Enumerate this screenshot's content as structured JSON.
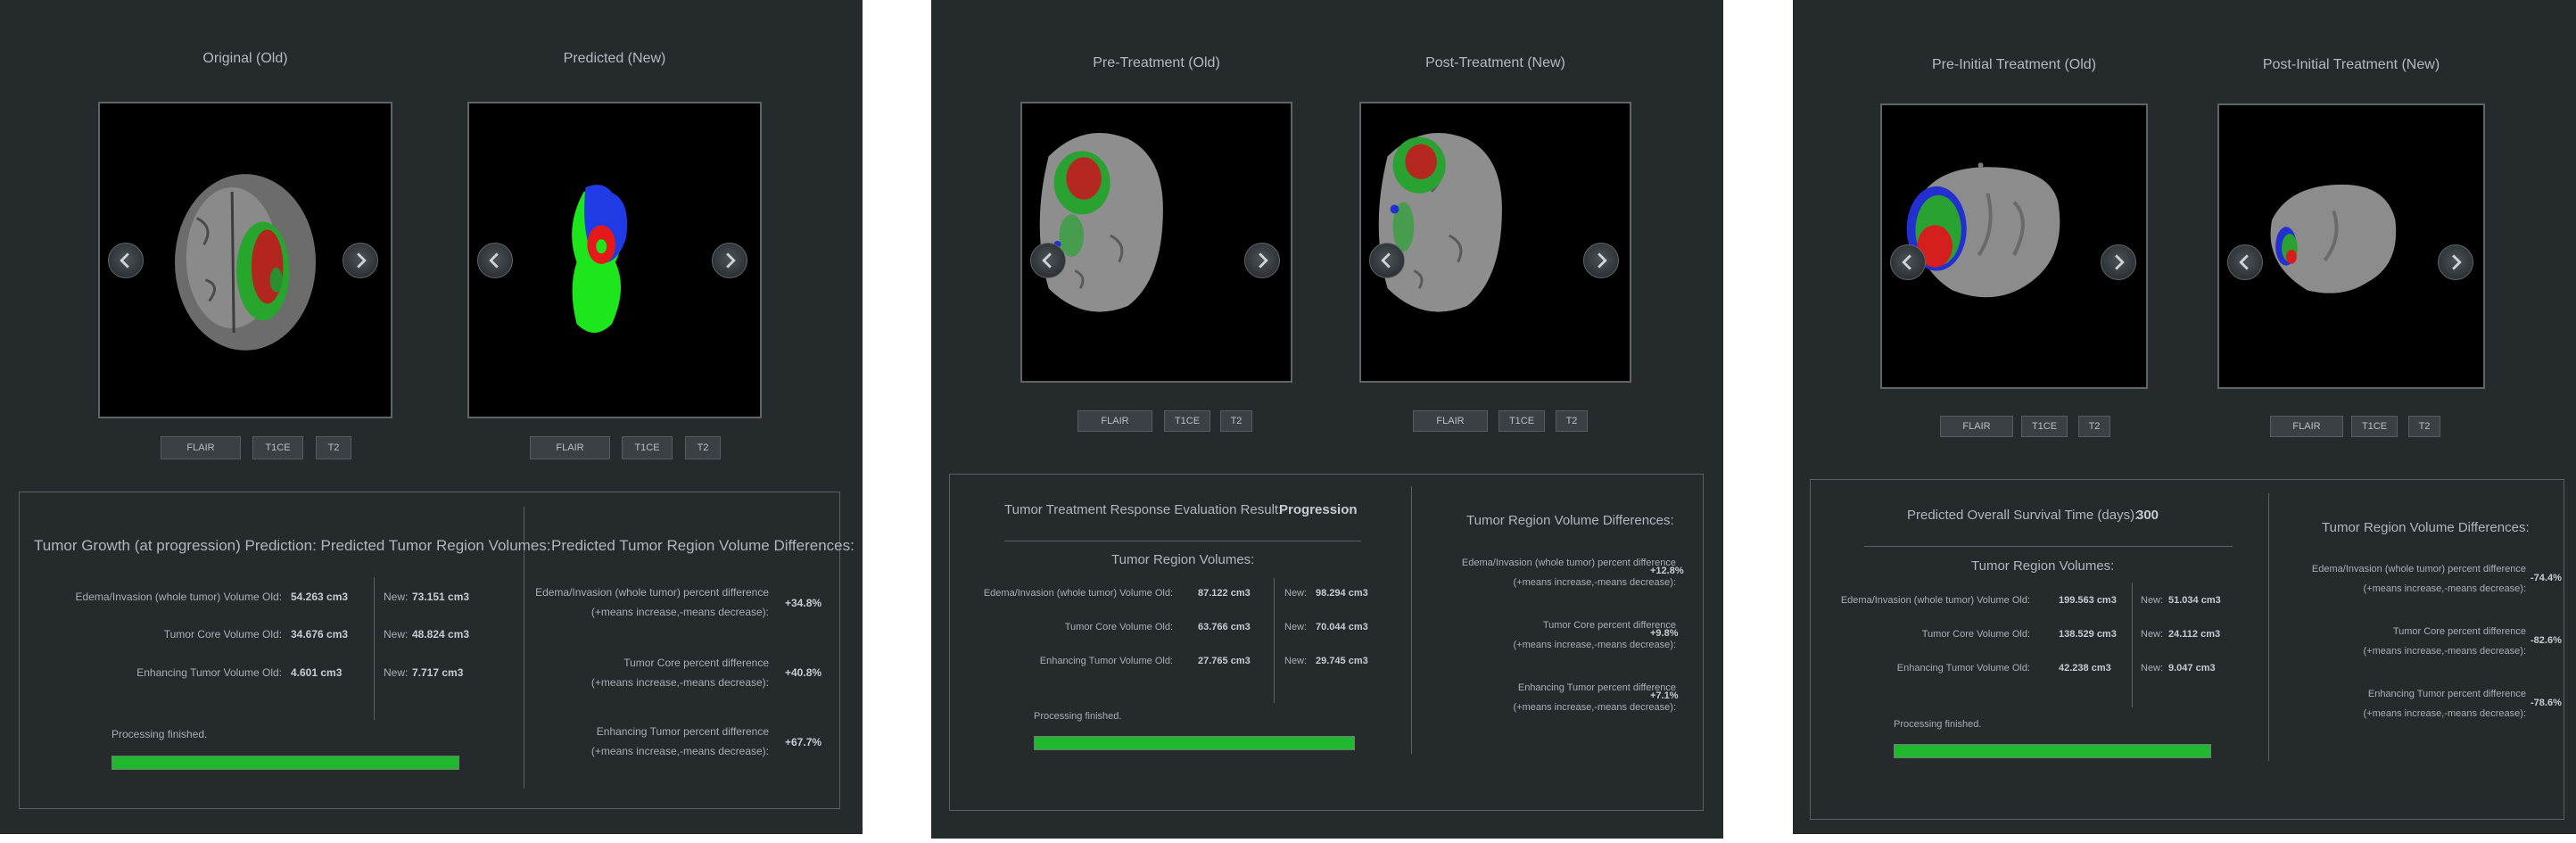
{
  "colors": {
    "window_bg": "#252a2d",
    "progress": "#1fb82e"
  },
  "icons": {
    "prev": "chevron-left-icon",
    "next": "chevron-right-icon"
  },
  "windows": [
    {
      "image_titles": [
        "Original (Old)",
        "Predicted (New)"
      ],
      "modalities": [
        "FLAIR",
        "T1CE",
        "T2"
      ],
      "left_heading": "Tumor Growth (at progression) Prediction: Predicted Tumor Region Volumes:",
      "right_heading": "Predicted Tumor Region Volume Differences:",
      "volumes": [
        {
          "label": "Edema/Invasion (whole tumor) Volume Old:",
          "old": "54.263 cm3",
          "new_label": "New:",
          "new": "73.151 cm3"
        },
        {
          "label": "Tumor Core Volume Old:",
          "old": "34.676 cm3",
          "new_label": "New:",
          "new": "48.824 cm3"
        },
        {
          "label": "Enhancing Tumor Volume Old:",
          "old": "4.601 cm3",
          "new_label": "New:",
          "new": "7.717 cm3"
        }
      ],
      "diffs": [
        {
          "line1": "Edema/Invasion (whole tumor) percent difference",
          "line2": "(+means increase,-means decrease):",
          "value": "+34.8%"
        },
        {
          "line1": "Tumor Core percent difference",
          "line2": "(+means increase,-means decrease):",
          "value": "+40.8%"
        },
        {
          "line1": "Enhancing Tumor percent difference",
          "line2": "(+means increase,-means decrease):",
          "value": "+67.7%"
        }
      ],
      "status": "Processing finished.",
      "progress": 1.0
    },
    {
      "image_titles": [
        "Pre-Treatment (Old)",
        "Post-Treatment (New)"
      ],
      "modalities": [
        "FLAIR",
        "T1CE",
        "T2"
      ],
      "result_label": "Tumor Treatment Response Evaluation Result:",
      "result_value": "Progression",
      "left_heading": "Tumor Region Volumes:",
      "right_heading": "Tumor Region Volume Differences:",
      "volumes": [
        {
          "label": "Edema/Invasion (whole tumor) Volume Old:",
          "old": "87.122 cm3",
          "new_label": "New:",
          "new": "98.294 cm3"
        },
        {
          "label": "Tumor Core Volume Old:",
          "old": "63.766 cm3",
          "new_label": "New:",
          "new": "70.044 cm3"
        },
        {
          "label": "Enhancing Tumor Volume Old:",
          "old": "27.765 cm3",
          "new_label": "New:",
          "new": "29.745 cm3"
        }
      ],
      "diffs": [
        {
          "line1": "Edema/Invasion (whole tumor) percent difference",
          "line2": "(+means increase,-means decrease):",
          "value": "+12.8%"
        },
        {
          "line1": "Tumor Core percent difference",
          "line2": "(+means increase,-means decrease):",
          "value": "+9.8%"
        },
        {
          "line1": "Enhancing Tumor percent difference",
          "line2": "(+means increase,-means decrease):",
          "value": "+7.1%"
        }
      ],
      "status": "Processing finished.",
      "progress": 1.0
    },
    {
      "image_titles": [
        "Pre-Initial Treatment (Old)",
        "Post-Initial Treatment (New)"
      ],
      "modalities": [
        "FLAIR",
        "T1CE",
        "T2"
      ],
      "result_label": "Predicted Overall Survival Time (days):",
      "result_value": "300",
      "left_heading": "Tumor Region Volumes:",
      "right_heading": "Tumor Region Volume Differences:",
      "volumes": [
        {
          "label": "Edema/Invasion (whole tumor) Volume Old:",
          "old": "199.563 cm3",
          "new_label": "New:",
          "new": "51.034 cm3"
        },
        {
          "label": "Tumor Core Volume Old:",
          "old": "138.529 cm3",
          "new_label": "New:",
          "new": "24.112 cm3"
        },
        {
          "label": "Enhancing Tumor Volume Old:",
          "old": "42.238 cm3",
          "new_label": "New:",
          "new": "9.047 cm3"
        }
      ],
      "diffs": [
        {
          "line1": "Edema/Invasion (whole tumor) percent difference",
          "line2": "(+means increase,-means decrease):",
          "value": "-74.4%"
        },
        {
          "line1": "Tumor Core percent difference",
          "line2": "(+means increase,-means decrease):",
          "value": "-82.6%"
        },
        {
          "line1": "Enhancing Tumor percent difference",
          "line2": "(+means increase,-means decrease):",
          "value": "-78.6%"
        }
      ],
      "status": "Processing finished.",
      "progress": 1.0
    }
  ]
}
